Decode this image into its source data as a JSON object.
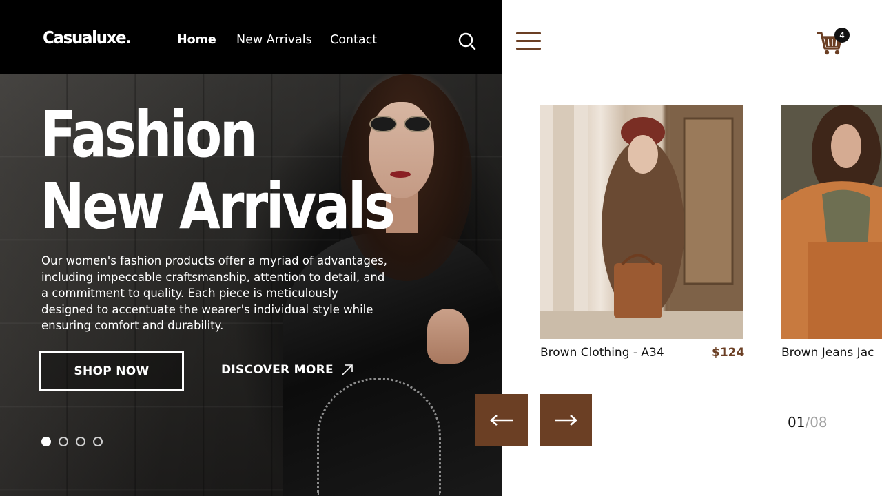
{
  "brand": {
    "logo": "Casualuxe."
  },
  "nav": {
    "items": [
      {
        "label": "Home",
        "active": true
      },
      {
        "label": "New Arrivals",
        "active": false
      },
      {
        "label": "Contact",
        "active": false
      }
    ],
    "search_icon": "search-icon"
  },
  "hero": {
    "title_line1": "Fashion",
    "title_line2": "New Arrivals",
    "description": "Our women's fashion products offer a myriad of advantages,\n including impeccable craftsmanship, attention to detail, and\n a commitment to quality. Each piece is meticulously\ndesigned to accentuate the wearer's individual style while\nensuring comfort and durability.",
    "primary_button": "SHOP NOW",
    "secondary_button": "DISCOVER MORE",
    "slides": 4,
    "active_slide": 1
  },
  "header_right": {
    "menu_icon": "hamburger-menu-icon",
    "cart_icon": "shopping-cart-icon",
    "cart_count": "4"
  },
  "products": [
    {
      "name": "Brown Clothing - A34",
      "price": "$124"
    },
    {
      "name": "Brown Jeans Jac",
      "price": ""
    }
  ],
  "pagination": {
    "current": "01",
    "total": "/08"
  },
  "colors": {
    "accent": "#6b3f24",
    "dark": "#000000",
    "text": "#111111",
    "muted": "#a0a0a0"
  }
}
